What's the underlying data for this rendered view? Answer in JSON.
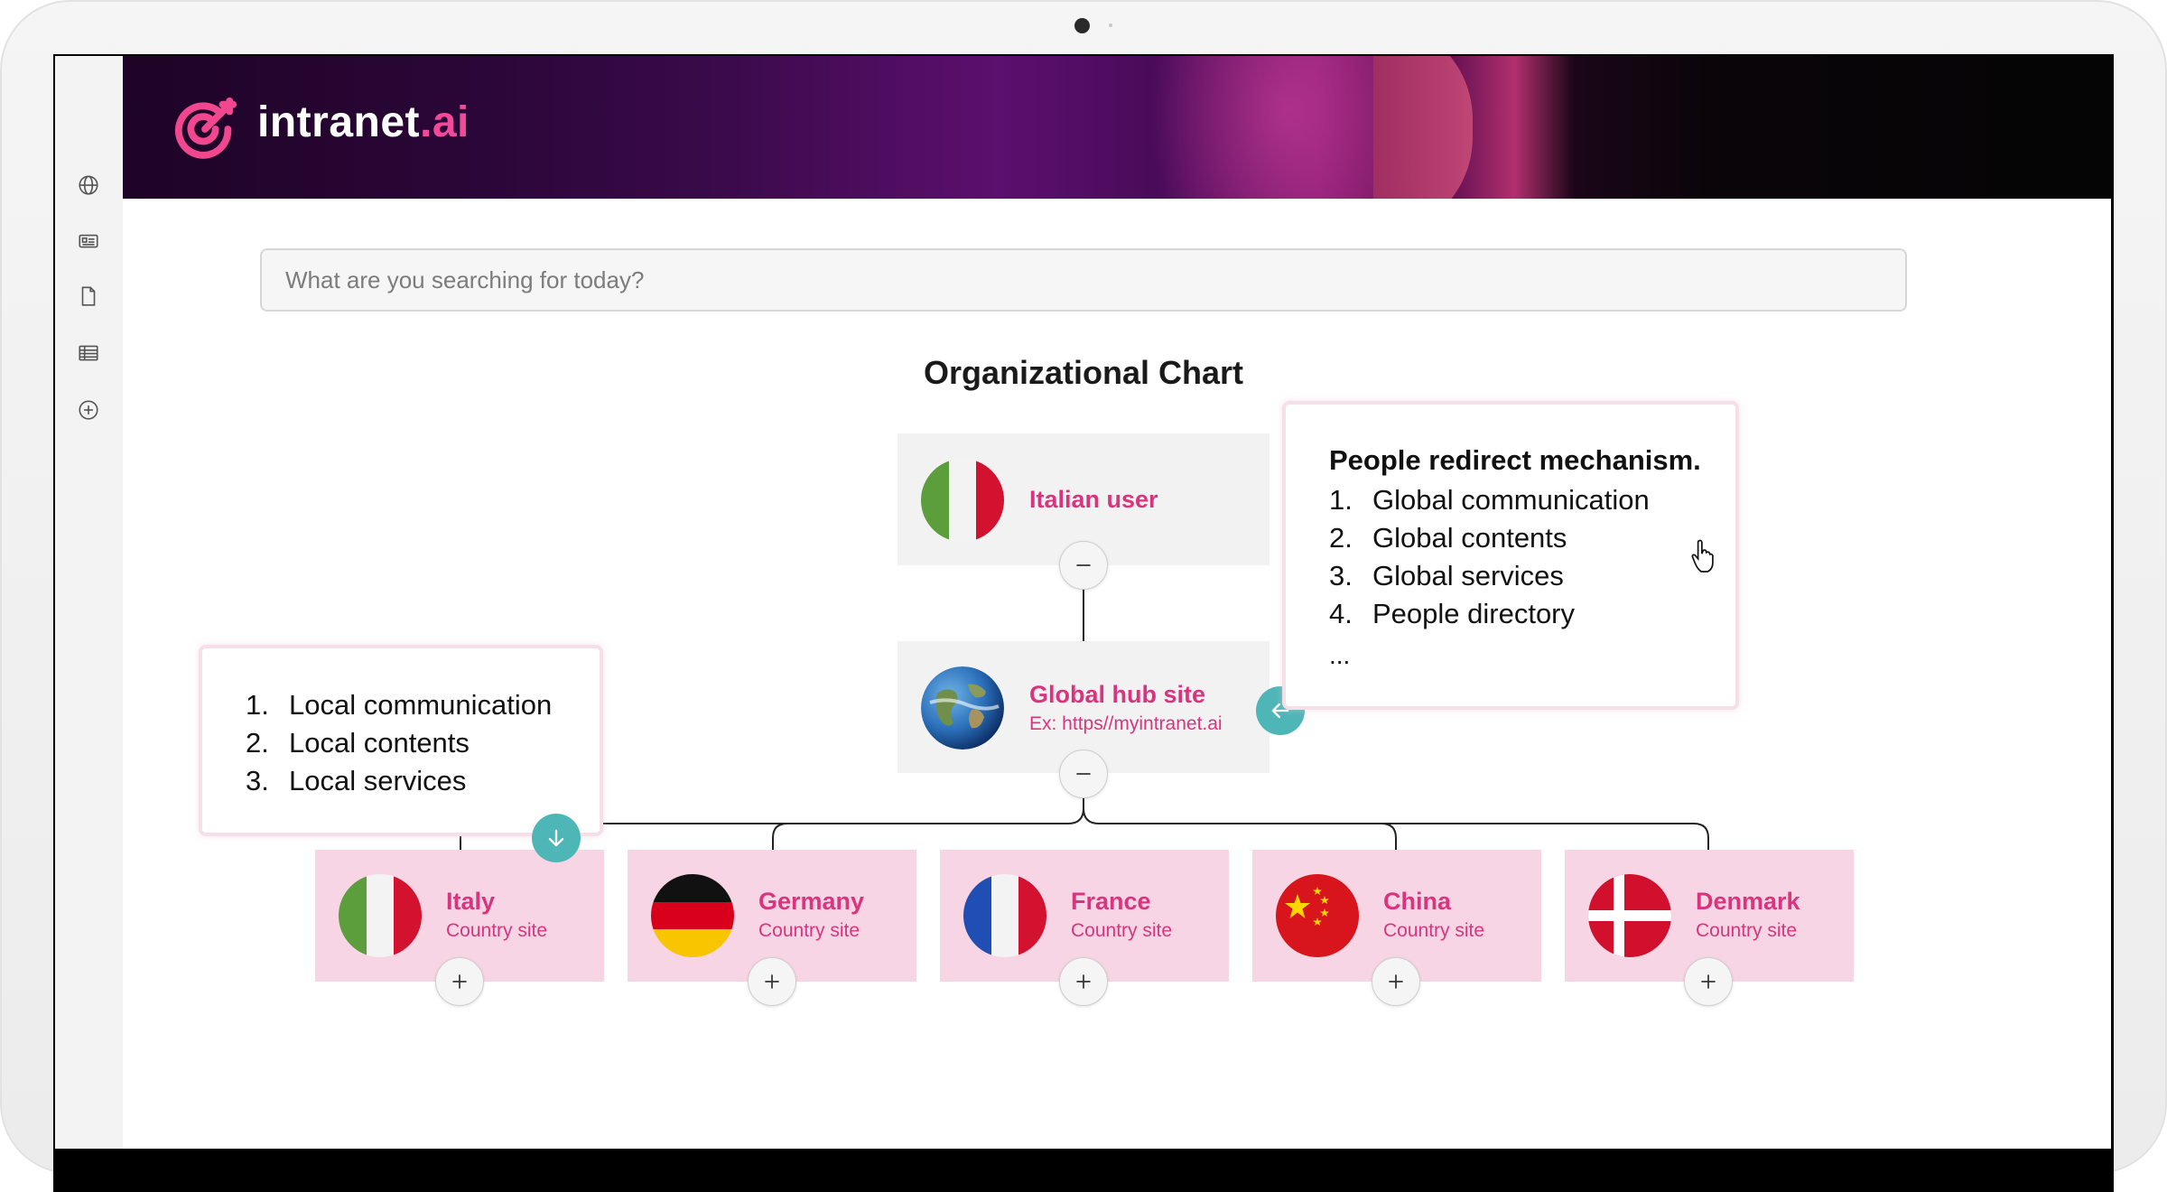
{
  "brand": {
    "name": "intranet",
    "suffix": ".ai"
  },
  "search": {
    "placeholder": "What are you searching for today?"
  },
  "sidebar": {
    "items": [
      {
        "icon": "globe-icon"
      },
      {
        "icon": "news-icon"
      },
      {
        "icon": "document-icon"
      },
      {
        "icon": "table-icon"
      },
      {
        "icon": "add-circle-icon"
      }
    ]
  },
  "chart": {
    "title": "Organizational Chart",
    "user": {
      "title": "Italian user"
    },
    "hub": {
      "title": "Global hub site",
      "subtitle": "Ex: https//myintranet.ai"
    },
    "countries": [
      {
        "title": "Italy",
        "subtitle": "Country site"
      },
      {
        "title": "Germany",
        "subtitle": "Country site"
      },
      {
        "title": "France",
        "subtitle": "Country site"
      },
      {
        "title": "China",
        "subtitle": "Country site"
      },
      {
        "title": "Denmark",
        "subtitle": "Country site"
      }
    ]
  },
  "redirect_callout": {
    "title": "People redirect mechanism.",
    "items": [
      {
        "num": "1.",
        "label": "Global communication"
      },
      {
        "num": "2.",
        "label": "Global contents"
      },
      {
        "num": "3.",
        "label": "Global services"
      },
      {
        "num": "4.",
        "label": "People directory"
      }
    ],
    "more": "..."
  },
  "local_callout": {
    "items": [
      {
        "num": "1.",
        "label": "Local communication"
      },
      {
        "num": "2.",
        "label": "Local contents"
      },
      {
        "num": "3.",
        "label": "Local services"
      }
    ]
  },
  "colors": {
    "accent": "#d9357f",
    "teal": "#4fb6b8",
    "country_bg": "#f8d5e4",
    "node_bg": "#f2f2f2"
  }
}
